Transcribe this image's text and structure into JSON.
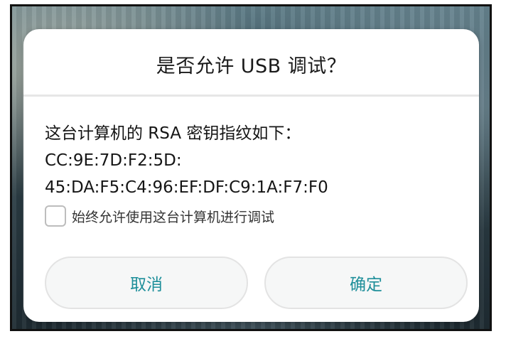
{
  "dialog": {
    "title": "是否允许 USB 调试？",
    "message_lines": [
      "这台计算机的 RSA 密钥指纹如下：",
      "CC:9E:7D:F2:5D:",
      "45:DA:F5:C4:96:EF:DF:C9:1A:F7:F0"
    ],
    "always_allow_label": "始终允许使用这台计算机进行调试",
    "always_allow_checked": false,
    "cancel_label": "取消",
    "confirm_label": "确定"
  },
  "colors": {
    "accent": "#1e8f9a",
    "dialog_background": "#ffffff",
    "button_background": "#f6f7f7"
  }
}
